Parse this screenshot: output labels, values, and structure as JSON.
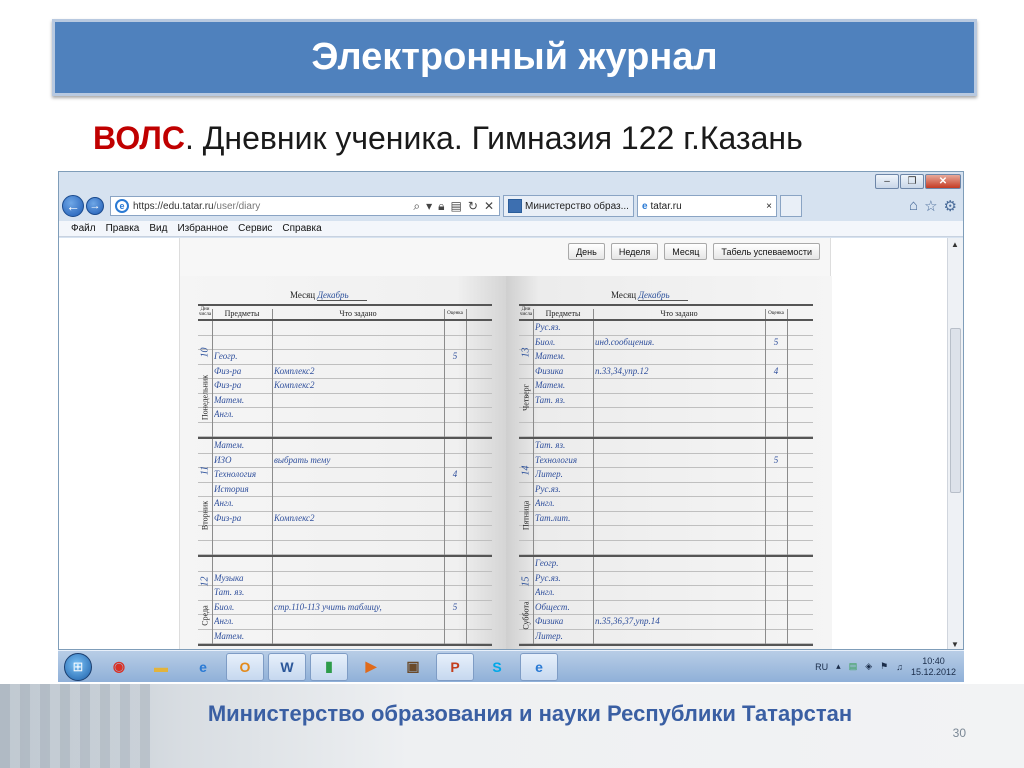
{
  "slide": {
    "title": "Электронный журнал",
    "subtitle_accent": "ВОЛС",
    "subtitle_rest": ".  Дневник ученика. Гимназия 122 г.Казань",
    "footer": "Министерство образования и науки Республики Татарстан",
    "page_number": "30"
  },
  "browser": {
    "window_controls": [
      "–",
      "❐",
      "✕"
    ],
    "url_host": "https://edu.tatar.ru",
    "url_path": "/user/diary",
    "tabs": [
      {
        "label": "Министерство образ..."
      },
      {
        "label": "tatar.ru",
        "close": "×"
      }
    ],
    "menu": [
      "Файл",
      "Правка",
      "Вид",
      "Избранное",
      "Сервис",
      "Справка"
    ]
  },
  "diary": {
    "view_buttons": [
      "День",
      "Неделя",
      "Месяц",
      "Табель успеваемости"
    ],
    "month_label": "Месяц",
    "month_value": "Декабрь",
    "columns": {
      "day": "Дни числа",
      "subjects": "Предметы",
      "homework": "Что задано",
      "grade": "Оценка"
    },
    "left_days": [
      {
        "name": "Понедельник",
        "number": "10",
        "rows": [
          {
            "subject": "",
            "homework": "",
            "grade": ""
          },
          {
            "subject": "",
            "homework": "",
            "grade": ""
          },
          {
            "subject": "Геогр.",
            "homework": "",
            "grade": "5"
          },
          {
            "subject": "Физ-ра",
            "homework": "Комплекс2",
            "grade": ""
          },
          {
            "subject": "Физ-ра",
            "homework": "Комплекс2",
            "grade": ""
          },
          {
            "subject": "Матем.",
            "homework": "",
            "grade": ""
          },
          {
            "subject": "Англ.",
            "homework": "",
            "grade": ""
          },
          {
            "subject": "",
            "homework": "",
            "grade": ""
          }
        ]
      },
      {
        "name": "Вторник",
        "number": "11",
        "rows": [
          {
            "subject": "Матем.",
            "homework": "",
            "grade": ""
          },
          {
            "subject": "ИЗО",
            "homework": "выбрать тему",
            "grade": ""
          },
          {
            "subject": "Технология",
            "homework": "",
            "grade": "4"
          },
          {
            "subject": "История",
            "homework": "",
            "grade": ""
          },
          {
            "subject": "Англ.",
            "homework": "",
            "grade": ""
          },
          {
            "subject": "Физ-ра",
            "homework": "Комплекс2",
            "grade": ""
          },
          {
            "subject": "",
            "homework": "",
            "grade": ""
          },
          {
            "subject": "",
            "homework": "",
            "grade": ""
          }
        ]
      },
      {
        "name": "Среда",
        "number": "12",
        "rows": [
          {
            "subject": "",
            "homework": "",
            "grade": ""
          },
          {
            "subject": "Музыка",
            "homework": "",
            "grade": ""
          },
          {
            "subject": "Тат. яз.",
            "homework": "",
            "grade": ""
          },
          {
            "subject": "Биол.",
            "homework": "стр.110-113 учить таблицу,",
            "grade": "5"
          },
          {
            "subject": "Англ.",
            "homework": "",
            "grade": ""
          },
          {
            "subject": "Матем.",
            "homework": "",
            "grade": ""
          }
        ]
      }
    ],
    "right_days": [
      {
        "name": "Четверг",
        "number": "13",
        "rows": [
          {
            "subject": "Рус.яз.",
            "homework": "",
            "grade": ""
          },
          {
            "subject": "Биол.",
            "homework": "инд.сообщения.",
            "grade": "5"
          },
          {
            "subject": "Матем.",
            "homework": "",
            "grade": ""
          },
          {
            "subject": "Физика",
            "homework": "п.33,34,упр.12",
            "grade": "4"
          },
          {
            "subject": "Матем.",
            "homework": "",
            "grade": ""
          },
          {
            "subject": "Тат. яз.",
            "homework": "",
            "grade": ""
          },
          {
            "subject": "",
            "homework": "",
            "grade": ""
          },
          {
            "subject": "",
            "homework": "",
            "grade": ""
          }
        ]
      },
      {
        "name": "Пятница",
        "number": "14",
        "rows": [
          {
            "subject": "Тат. яз.",
            "homework": "",
            "grade": ""
          },
          {
            "subject": "Технология",
            "homework": "",
            "grade": "5"
          },
          {
            "subject": "Литер.",
            "homework": "",
            "grade": ""
          },
          {
            "subject": "Рус.яз.",
            "homework": "",
            "grade": ""
          },
          {
            "subject": "Англ.",
            "homework": "",
            "grade": ""
          },
          {
            "subject": "Тат.лит.",
            "homework": "",
            "grade": ""
          },
          {
            "subject": "",
            "homework": "",
            "grade": ""
          },
          {
            "subject": "",
            "homework": "",
            "grade": ""
          }
        ]
      },
      {
        "name": "Суббота",
        "number": "15",
        "rows": [
          {
            "subject": "Геогр.",
            "homework": "",
            "grade": ""
          },
          {
            "subject": "Рус.яз.",
            "homework": "",
            "grade": ""
          },
          {
            "subject": "Англ.",
            "homework": "",
            "grade": ""
          },
          {
            "subject": "Общест.",
            "homework": "",
            "grade": ""
          },
          {
            "subject": "Физика",
            "homework": "п.35,36,37,упр.14",
            "grade": ""
          },
          {
            "subject": "Литер.",
            "homework": "",
            "grade": ""
          }
        ]
      }
    ]
  },
  "taskbar": {
    "lang": "RU",
    "time": "10:40",
    "date": "15.12.2012",
    "apps": [
      {
        "name": "chrome-icon",
        "glyph": "◉",
        "color": "#d93025"
      },
      {
        "name": "folder-icon",
        "glyph": "▬",
        "color": "#e2b33c"
      },
      {
        "name": "ie-icon",
        "glyph": "e",
        "color": "#2a7ad4"
      },
      {
        "name": "outlook-icon",
        "glyph": "O",
        "color": "#e38a1c"
      },
      {
        "name": "word-icon",
        "glyph": "W",
        "color": "#2b579a"
      },
      {
        "name": "chart-app-icon",
        "glyph": "▮",
        "color": "#2e9c4a"
      },
      {
        "name": "media-player-icon",
        "glyph": "▶",
        "color": "#e06a1a"
      },
      {
        "name": "briefcase-icon",
        "glyph": "▣",
        "color": "#6a4a2a"
      },
      {
        "name": "powerpoint-icon",
        "glyph": "P",
        "color": "#c43e1c"
      },
      {
        "name": "skype-icon",
        "glyph": "S",
        "color": "#00a8e8"
      },
      {
        "name": "ie-icon-2",
        "glyph": "e",
        "color": "#2a7ad4"
      }
    ]
  }
}
